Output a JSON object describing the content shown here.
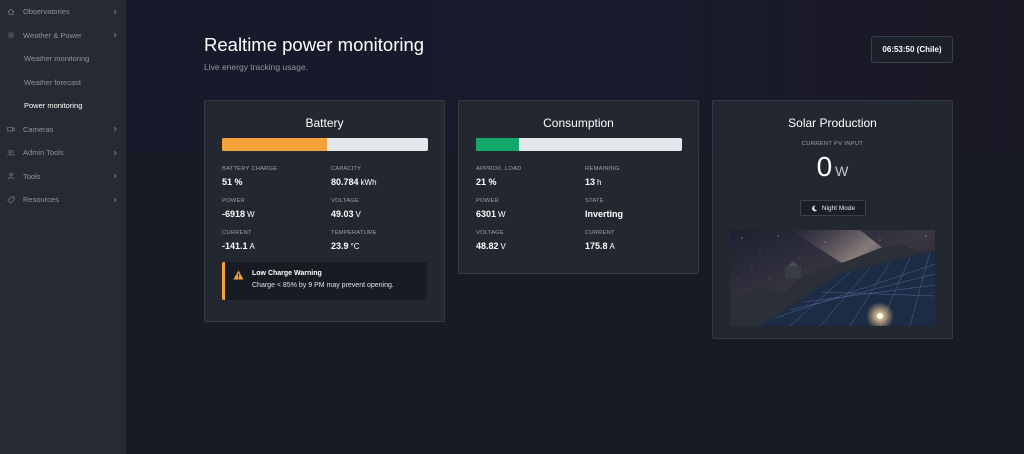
{
  "sidebar": {
    "items": [
      {
        "label": "Observatories",
        "icon": "home-icon",
        "has_chevron": true
      },
      {
        "label": "Weather & Power",
        "icon": "sun-icon",
        "has_chevron": true
      },
      {
        "label": "Weather monitoring",
        "sub": true
      },
      {
        "label": "Weather forecast",
        "sub": true
      },
      {
        "label": "Power monitoring",
        "sub": true,
        "active": true
      },
      {
        "label": "Cameras",
        "icon": "camera-icon",
        "has_chevron": true
      },
      {
        "label": "Admin Tools",
        "icon": "users-icon",
        "has_chevron": true
      },
      {
        "label": "Tools",
        "icon": "user-icon",
        "has_chevron": true
      },
      {
        "label": "Resources",
        "icon": "tag-icon",
        "has_chevron": true
      }
    ]
  },
  "header": {
    "title": "Realtime power monitoring",
    "subtitle": "Live energy tracking usage.",
    "clock": "06:53:50 (Chile)"
  },
  "battery": {
    "title": "Battery",
    "charge_percent": 51,
    "bar_color": "#f5a23a",
    "stats": {
      "charge": {
        "label": "BATTERY CHARGE",
        "value": "51 %",
        "unit": ""
      },
      "capacity": {
        "label": "CAPACITY",
        "value": "80.784",
        "unit": "kWh"
      },
      "power": {
        "label": "POWER",
        "value": "-6918",
        "unit": "W"
      },
      "voltage": {
        "label": "VOLTAGE",
        "value": "49.03",
        "unit": "V"
      },
      "current": {
        "label": "CURRENT",
        "value": "-141.1",
        "unit": "A"
      },
      "temperature": {
        "label": "TEMPERATURE",
        "value": "23.9",
        "unit": "°C"
      }
    },
    "warning": {
      "title": "Low Charge Warning",
      "message": "Charge < 85% by 9 PM may prevent opening.",
      "color": "#f5a23a"
    }
  },
  "consumption": {
    "title": "Consumption",
    "load_percent": 21,
    "bar_color": "#12a86a",
    "stats": {
      "load": {
        "label": "APPROX. LOAD",
        "value": "21 %",
        "unit": ""
      },
      "remaining": {
        "label": "REMAINING",
        "value": "13",
        "unit": "h"
      },
      "power": {
        "label": "POWER",
        "value": "6301",
        "unit": "W"
      },
      "state": {
        "label": "STATE",
        "value": "Inverting",
        "unit": ""
      },
      "voltage": {
        "label": "VOLTAGE",
        "value": "48.82",
        "unit": "V"
      },
      "current": {
        "label": "CURRENT",
        "value": "175.8",
        "unit": "A"
      }
    }
  },
  "solar": {
    "title": "Solar Production",
    "pv_label": "CURRENT PV INPUT",
    "pv_value": "0",
    "pv_unit": "W",
    "night_mode_label": "Night Mode"
  }
}
